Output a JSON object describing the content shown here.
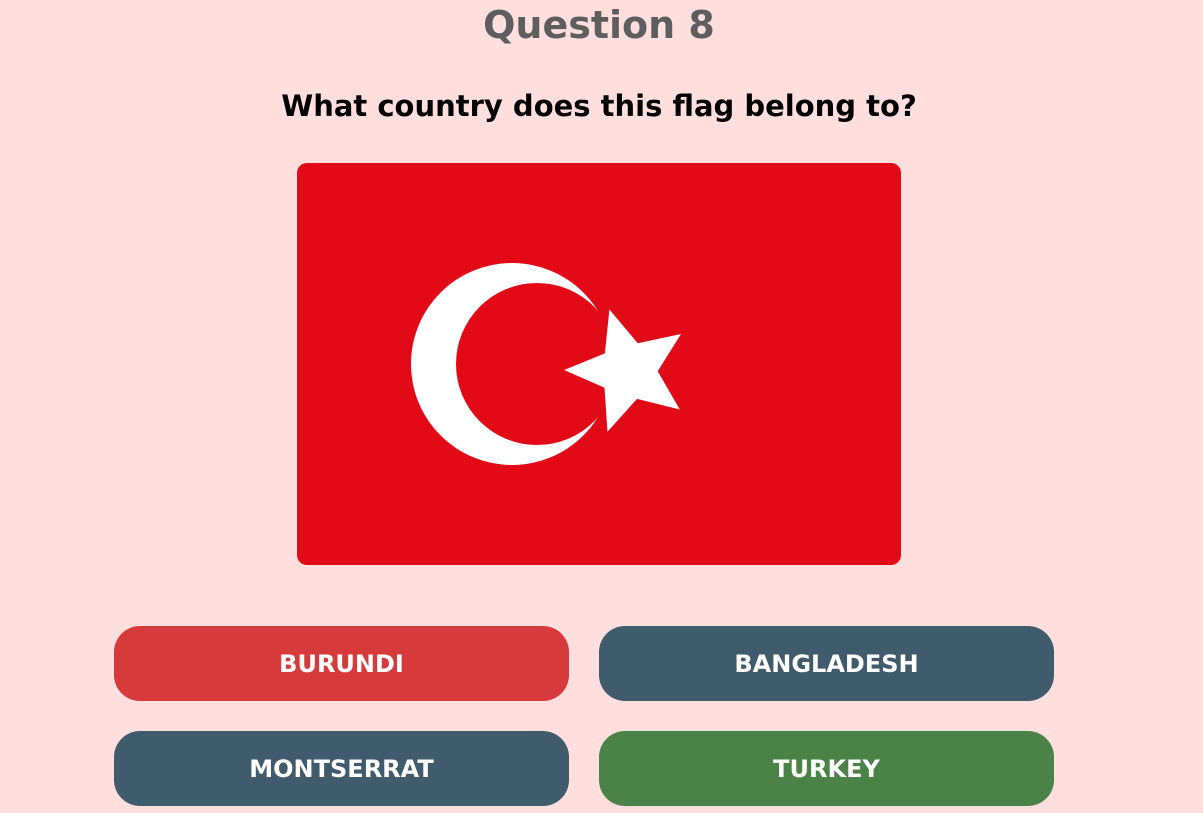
{
  "quiz": {
    "heading": "Question 8",
    "prompt": "What country does this flag belong to?",
    "flag": {
      "icon": "flag-turkey-icon",
      "colors": {
        "field": "#E30A17",
        "emblem": "#FFFFFF"
      }
    },
    "answers": [
      {
        "label": "BURUNDI",
        "state": "incorrect",
        "color": "#D63A3A"
      },
      {
        "label": "BANGLADESH",
        "state": "neutral",
        "color": "#405B6C"
      },
      {
        "label": "MONTSERRAT",
        "state": "neutral",
        "color": "#405B6C"
      },
      {
        "label": "TURKEY",
        "state": "correct",
        "color": "#4A8247"
      }
    ]
  },
  "colors": {
    "background": "#FFDEDE",
    "heading": "#5E5E5E",
    "prompt": "#000000"
  }
}
